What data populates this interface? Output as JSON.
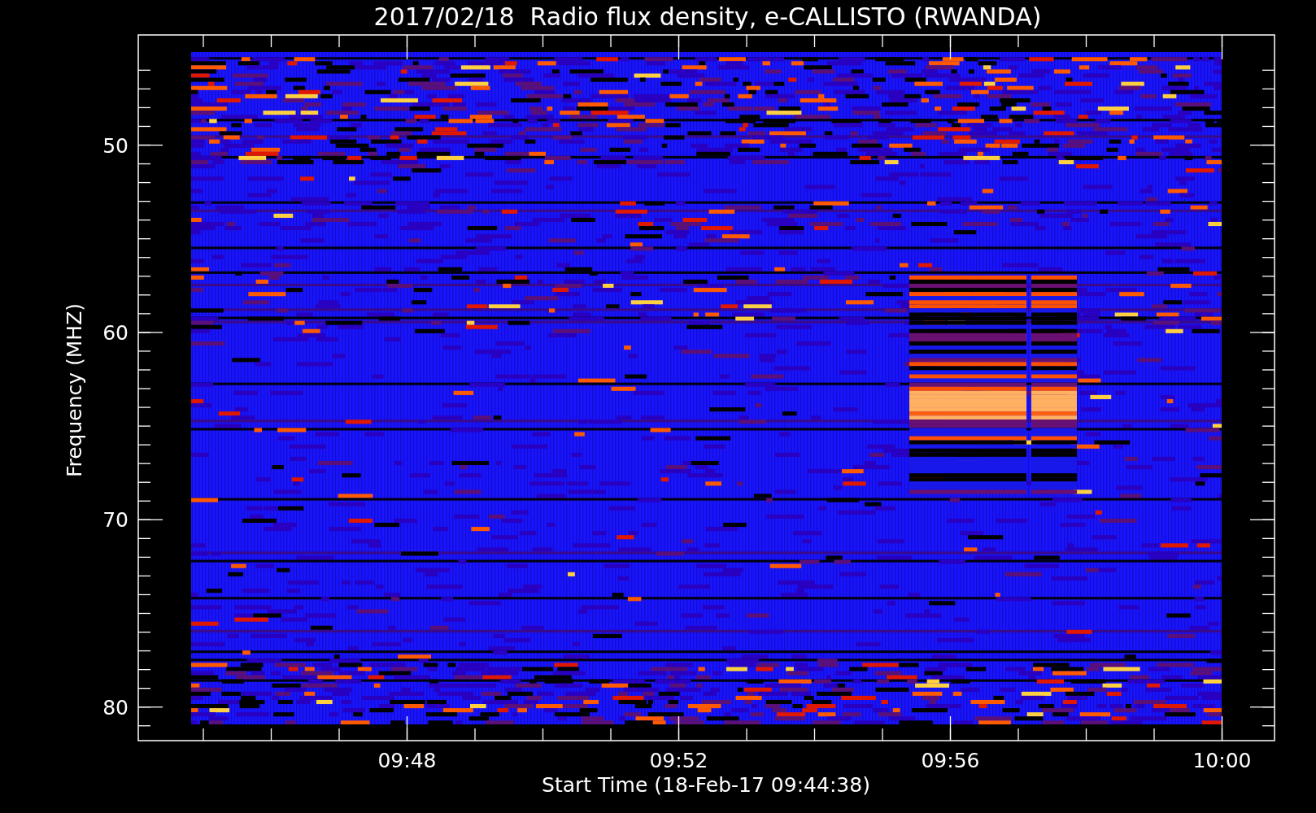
{
  "title": "2017/02/18  Radio flux density, e-CALLISTO (RWANDA)",
  "y_axis": {
    "label": "Frequency (MHZ)",
    "ticks": [
      "50",
      "60",
      "70",
      "80"
    ]
  },
  "x_axis": {
    "label": "Start Time (18-Feb-17 09:44:38)",
    "ticks": [
      "09:48",
      "09:52",
      "09:56",
      "10:00"
    ]
  }
}
